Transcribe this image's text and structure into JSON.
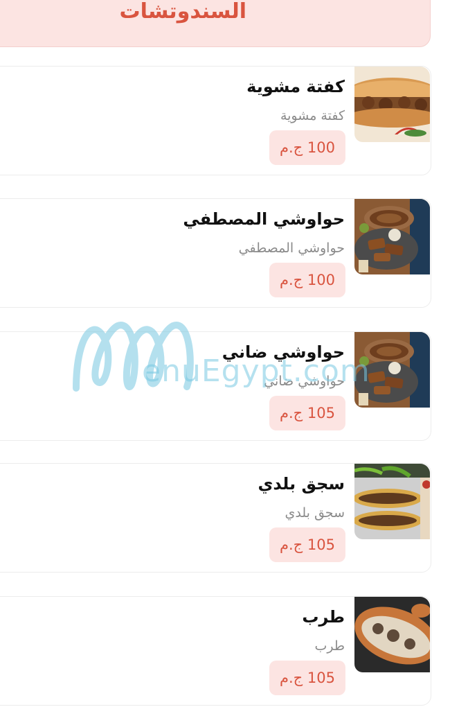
{
  "category": {
    "title": "السندوتشات"
  },
  "items": [
    {
      "name": "كفتة مشوية",
      "description": "كفتة مشوية",
      "price": "100 ج.م",
      "image_icon": "kofta-sandwich-image"
    },
    {
      "name": "حواوشي المصطفي",
      "description": "حواوشي المصطفي",
      "price": "100 ج.م",
      "image_icon": "hawawshi-plate-image"
    },
    {
      "name": "حواوشي ضاني",
      "description": "حواوشي ضاني",
      "price": "105 ج.م",
      "image_icon": "hawawshi-plate-image"
    },
    {
      "name": "سجق بلدي",
      "description": "سجق بلدي",
      "price": "105 ج.م",
      "image_icon": "sausage-sandwich-image"
    },
    {
      "name": "طرب",
      "description": "طرب",
      "price": "105 ج.م",
      "image_icon": "tarb-sandwich-image"
    }
  ],
  "watermark": {
    "text": "enuEgypt.com"
  },
  "colors": {
    "accent": "#d9543f",
    "badge_bg": "#fce4e2",
    "watermark": "#78c8e1"
  }
}
